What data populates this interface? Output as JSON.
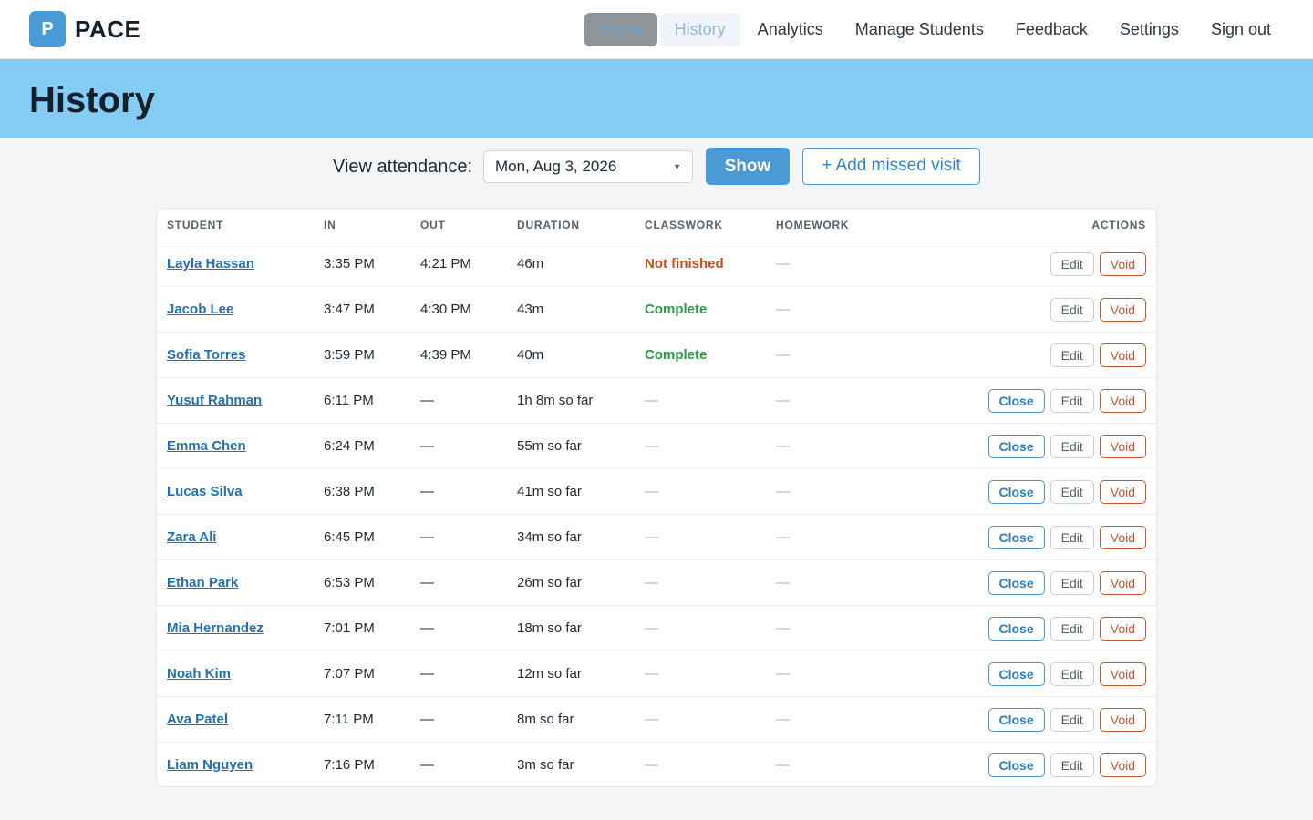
{
  "app": {
    "logo_letter": "P",
    "brand": "PACE"
  },
  "nav": {
    "items": [
      {
        "label": "Home"
      },
      {
        "label": "History"
      },
      {
        "label": "Analytics"
      },
      {
        "label": "Manage Students"
      },
      {
        "label": "Feedback"
      },
      {
        "label": "Settings"
      },
      {
        "label": "Sign out"
      }
    ]
  },
  "page": {
    "title": "History"
  },
  "controls": {
    "label": "View attendance:",
    "date_value": "Mon, Aug 3, 2026",
    "show_label": "Show",
    "add_missed_label": "+ Add missed visit"
  },
  "table": {
    "headers": {
      "student": "STUDENT",
      "in": "IN",
      "out": "OUT",
      "duration": "DURATION",
      "classwork": "CLASSWORK",
      "homework": "HOMEWORK",
      "actions": "ACTIONS"
    },
    "action_labels": {
      "close": "Close",
      "edit": "Edit",
      "void": "Void"
    },
    "rows": [
      {
        "student": "Layla Hassan",
        "in": "3:35 PM",
        "out": "4:21 PM",
        "duration": "46m",
        "classwork": "Not finished",
        "homework": "—"
      },
      {
        "student": "Jacob Lee",
        "in": "3:47 PM",
        "out": "4:30 PM",
        "duration": "43m",
        "classwork": "Complete",
        "homework": "—"
      },
      {
        "student": "Sofia Torres",
        "in": "3:59 PM",
        "out": "4:39 PM",
        "duration": "40m",
        "classwork": "Complete",
        "homework": "—"
      },
      {
        "student": "Yusuf Rahman",
        "in": "6:11 PM",
        "out": "—",
        "duration": "1h 8m so far",
        "classwork": "—",
        "homework": "—"
      },
      {
        "student": "Emma Chen",
        "in": "6:24 PM",
        "out": "—",
        "duration": "55m so far",
        "classwork": "—",
        "homework": "—"
      },
      {
        "student": "Lucas Silva",
        "in": "6:38 PM",
        "out": "—",
        "duration": "41m so far",
        "classwork": "—",
        "homework": "—"
      },
      {
        "student": "Zara Ali",
        "in": "6:45 PM",
        "out": "—",
        "duration": "34m so far",
        "classwork": "—",
        "homework": "—"
      },
      {
        "student": "Ethan Park",
        "in": "6:53 PM",
        "out": "—",
        "duration": "26m so far",
        "classwork": "—",
        "homework": "—"
      },
      {
        "student": "Mia Hernandez",
        "in": "7:01 PM",
        "out": "—",
        "duration": "18m so far",
        "classwork": "—",
        "homework": "—"
      },
      {
        "student": "Noah Kim",
        "in": "7:07 PM",
        "out": "—",
        "duration": "12m so far",
        "classwork": "—",
        "homework": "—"
      },
      {
        "student": "Ava Patel",
        "in": "7:11 PM",
        "out": "—",
        "duration": "8m so far",
        "classwork": "—",
        "homework": "—"
      },
      {
        "student": "Liam Nguyen",
        "in": "7:16 PM",
        "out": "—",
        "duration": "3m so far",
        "classwork": "—",
        "homework": "—"
      }
    ]
  },
  "colors": {
    "accent": "#4b9ad6",
    "hero": "#84ccf4",
    "status_not_finished": "#c3501f",
    "status_complete": "#2f9a4d",
    "void": "#c4572b"
  }
}
